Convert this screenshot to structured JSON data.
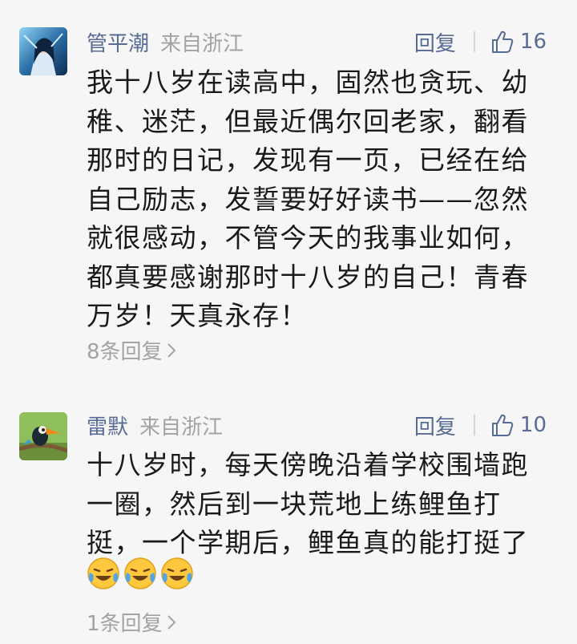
{
  "comments": [
    {
      "name": "管平潮",
      "location": "来自浙江",
      "reply_label": "回复",
      "like_count": "16",
      "text": "我十八岁在读高中，固然也贪玩、幼\n稚、迷茫，但最近偶尔回老家，翻看\n那时的日记，发现有一页，已经在给\n自己励志，发誓要好好读书——忽然\n就很感动，不管今天的我事业如何，\n都真要感谢那时十八岁的自己！青春\n万岁！天真永存！",
      "replies_label": "8条回复",
      "avatar_icon": "fantasy-character-avatar"
    },
    {
      "name": "雷默",
      "location": "来自浙江",
      "reply_label": "回复",
      "like_count": "10",
      "text": "十八岁时，每天傍晚沿着学校围墙跑\n一圈，然后到一块荒地上练鲤鱼打\n挺，一个学期后，鲤鱼真的能打挺了",
      "emoji_icon": "laughing-crying-emoji",
      "emoji_count": 3,
      "replies_label": "1条回复",
      "avatar_icon": "toucan-bird-avatar"
    }
  ],
  "colors": {
    "link": "#576b95",
    "muted": "#a3a3a3",
    "text": "#1a1a1a",
    "background": "#f6f6f6"
  }
}
